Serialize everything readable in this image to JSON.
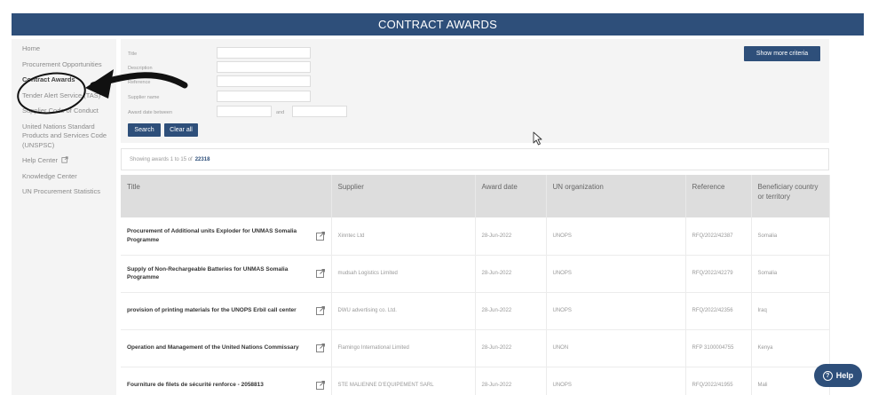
{
  "banner": {
    "title": "CONTRACT AWARDS"
  },
  "sidebar": {
    "items": [
      {
        "label": "Home"
      },
      {
        "label": "Procurement Opportunities"
      },
      {
        "label": "Contract Awards"
      },
      {
        "label": "Tender Alert Service (TAS)"
      },
      {
        "label": "Supplier Code of Conduct"
      },
      {
        "label": "United Nations Standard Products and Services Code (UNSPSC)"
      },
      {
        "label": "Help Center"
      },
      {
        "label": "Knowledge Center"
      },
      {
        "label": "UN Procurement Statistics"
      }
    ]
  },
  "search": {
    "labels": {
      "title": "Title",
      "description": "Description",
      "reference": "Reference",
      "supplier": "Supplier name",
      "award_date": "Award date between",
      "and": "and"
    },
    "values": {
      "title": "",
      "description": "",
      "reference": "",
      "supplier": "",
      "date_from": "",
      "date_to": ""
    },
    "search_button": "Search",
    "clear_button": "Clear all",
    "more_button": "Show more criteria"
  },
  "summary": {
    "text": "Showing awards 1 to 15 of",
    "total": "22318"
  },
  "table": {
    "headers": {
      "title": "Title",
      "supplier": "Supplier",
      "award_date": "Award date",
      "org": "UN organization",
      "reference": "Reference",
      "beneficiary": "Beneficiary country or territory"
    },
    "rows": [
      {
        "title": "Procurement of Additional units Exploder for UNMAS Somalia Programme",
        "supplier": "Xinntec Ltd",
        "date": "28-Jun-2022",
        "org": "UNOPS",
        "reference": "RFQ/2022/42387",
        "country": "Somalia"
      },
      {
        "title": "Supply of Non-Rechargeable Batteries for UNMAS Somalia Programme",
        "supplier": "mudsah Logistics Limited",
        "date": "28-Jun-2022",
        "org": "UNOPS",
        "reference": "RFQ/2022/42279",
        "country": "Somalia"
      },
      {
        "title": "provision of printing materials for the UNOPS Erbil call center",
        "supplier": "DWU advertising co. Ltd.",
        "date": "28-Jun-2022",
        "org": "UNOPS",
        "reference": "RFQ/2022/42356",
        "country": "Iraq"
      },
      {
        "title": "Operation and Management of the United Nations Commissary",
        "supplier": "Flamingo International Limited",
        "date": "28-Jun-2022",
        "org": "UNON",
        "reference": "RFP 3100004755",
        "country": "Kenya"
      },
      {
        "title": "Fourniture de filets de sécurité renforce - 2058813",
        "supplier": "STE MALIENNE D'EQUIPEMENT SARL",
        "date": "28-Jun-2022",
        "org": "UNOPS",
        "reference": "RFQ/2022/41955",
        "country": "Mali"
      }
    ]
  },
  "help": {
    "label": "Help"
  },
  "colors": {
    "brand": "#2e4f7a",
    "panel": "#f4f4f4",
    "header_row": "#dddddd"
  }
}
